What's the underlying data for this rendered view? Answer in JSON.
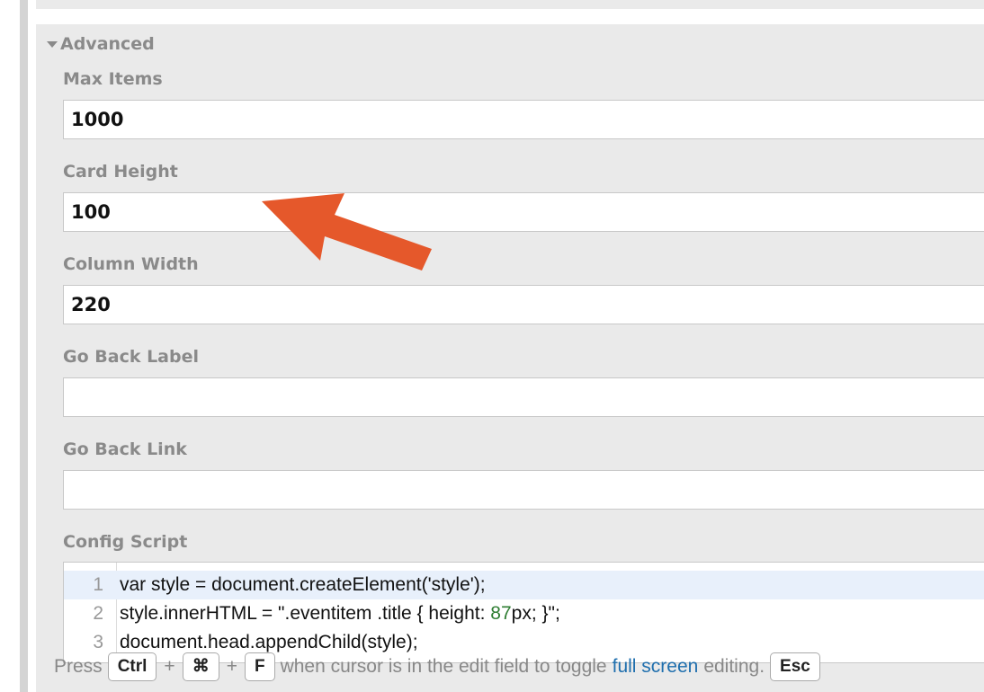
{
  "section": {
    "title": "Advanced"
  },
  "fields": [
    {
      "label": "Max Items",
      "value": "1000"
    },
    {
      "label": "Card Height",
      "value": "100"
    },
    {
      "label": "Column Width",
      "value": "220"
    },
    {
      "label": "Go Back Label",
      "value": ""
    },
    {
      "label": "Go Back Link",
      "value": ""
    }
  ],
  "config_script": {
    "label": "Config Script",
    "lines": [
      {
        "no": "1",
        "text": "var style = document.createElement('style');"
      },
      {
        "no": "2",
        "text_before": "style.innerHTML = \".eventitem .title { height: ",
        "number": "87",
        "text_after": "px; }\";"
      },
      {
        "no": "3",
        "text": "document.head.appendChild(style);"
      }
    ]
  },
  "hint": {
    "press": "Press",
    "key_ctrl": "Ctrl",
    "plus": "+",
    "key_cmd": "⌘",
    "key_f": "F",
    "middle": "when cursor is in the edit field to toggle",
    "link": "full screen",
    "editing": "editing.",
    "key_esc": "Esc"
  },
  "annotation": {
    "arrow_color": "#e5582b"
  }
}
